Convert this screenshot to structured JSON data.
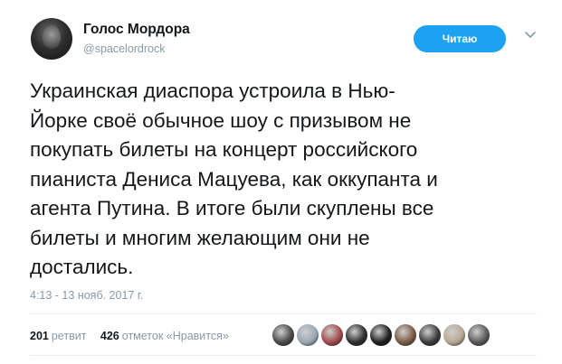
{
  "author": {
    "display_name": "Голос Мордора",
    "handle": "@spacelordrock"
  },
  "follow_button": {
    "label": "Читаю"
  },
  "caret_icon": "chevron-down-icon",
  "tweet": {
    "text_lines": [
      "Украинская диаспора устроила в Нью-",
      "Йорке своё обычное шоу с призывом не",
      "покупать билеты на концерт российского",
      "пианиста Дениса Мацуева, как оккупанта и",
      "агента Путина. В итоге были скуплены все",
      "билеты и многим желающим они не",
      "достались."
    ],
    "timestamp": "4:13 - 13 нояб. 2017 г."
  },
  "stats": {
    "retweets_count": "201",
    "retweets_label": "ретвит",
    "likes_count": "426",
    "likes_label": "отметок «Нравится»"
  },
  "likers": [
    {
      "color": "#4a4a4a"
    },
    {
      "color": "#9aa7b3"
    },
    {
      "color": "#a14a4a"
    },
    {
      "color": "#2e2e2e"
    },
    {
      "color": "#1f1f1f"
    },
    {
      "color": "#7b5b45"
    },
    {
      "color": "#3c3c3c"
    },
    {
      "color": "#b9a894"
    },
    {
      "color": "#5a5a5a"
    }
  ],
  "colors": {
    "accent": "#1da1f2",
    "muted": "#8899a6",
    "text": "#14171a"
  }
}
